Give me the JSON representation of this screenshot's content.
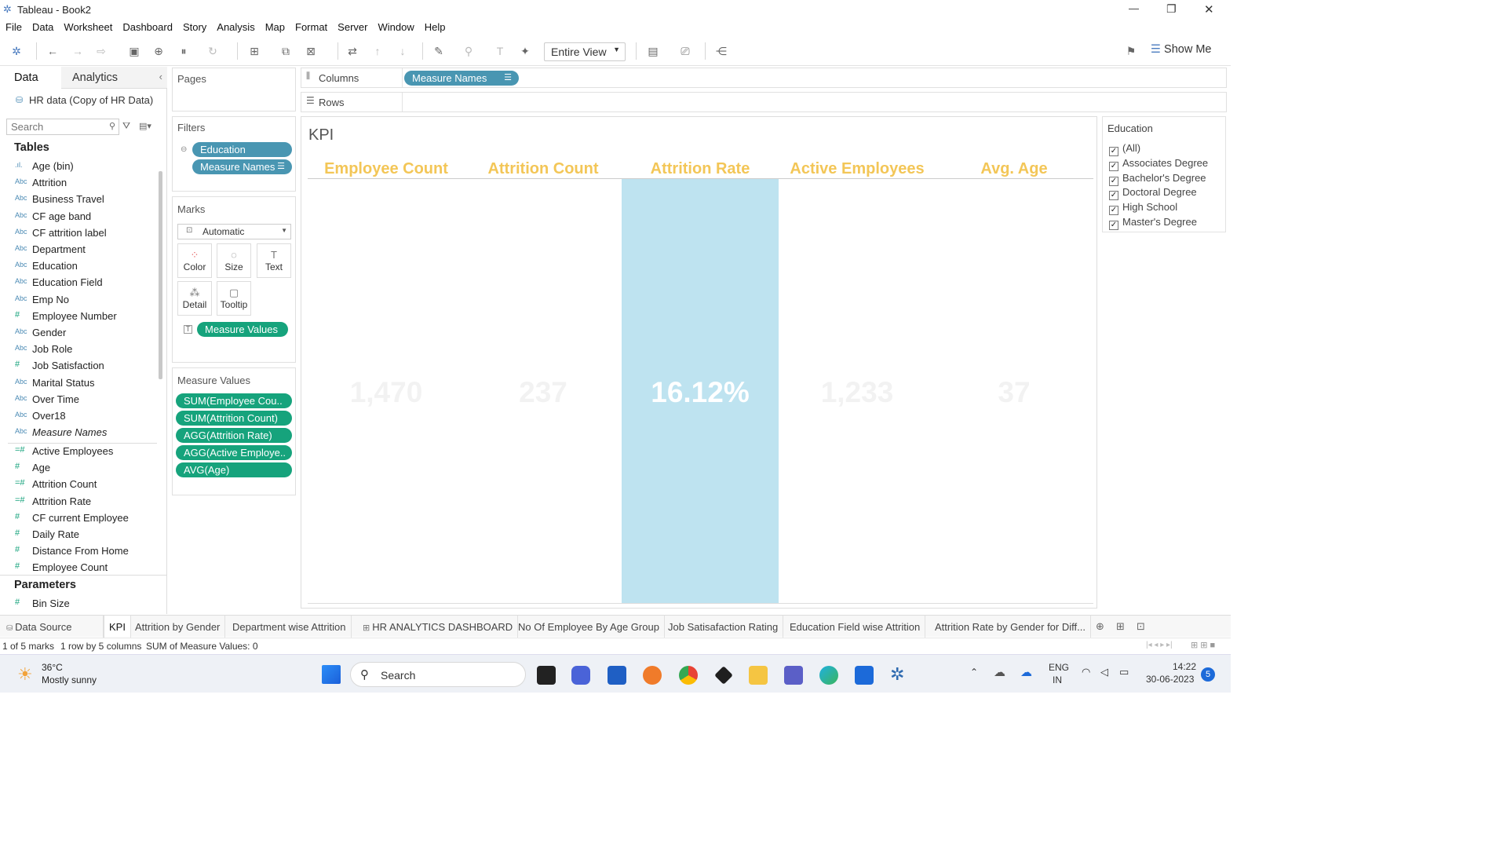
{
  "window": {
    "title": "Tableau - Book2",
    "minimize": "—",
    "restore": "❐",
    "close": "✕"
  },
  "menu": [
    "File",
    "Data",
    "Worksheet",
    "Dashboard",
    "Story",
    "Analysis",
    "Map",
    "Format",
    "Server",
    "Window",
    "Help"
  ],
  "toolbar": {
    "fit": "Entire View",
    "show_me": "Show Me"
  },
  "left": {
    "tab_data": "Data",
    "tab_analytics": "Analytics",
    "source": "HR data (Copy of HR Data)",
    "search_placeholder": "Search",
    "tables_header": "Tables",
    "parameters_header": "Parameters",
    "dims": [
      {
        "t": "Abc",
        "n": "Age (bin)",
        "type": "bin"
      },
      {
        "t": "Abc",
        "n": "Attrition"
      },
      {
        "t": "Abc",
        "n": "Business Travel"
      },
      {
        "t": "Abc",
        "n": "CF age band"
      },
      {
        "t": "Abc",
        "n": "CF attrition label"
      },
      {
        "t": "Abc",
        "n": "Department"
      },
      {
        "t": "Abc",
        "n": "Education"
      },
      {
        "t": "Abc",
        "n": "Education Field"
      },
      {
        "t": "Abc",
        "n": "Emp No"
      },
      {
        "t": "#",
        "n": "Employee Number"
      },
      {
        "t": "Abc",
        "n": "Gender"
      },
      {
        "t": "Abc",
        "n": "Job Role"
      },
      {
        "t": "#",
        "n": "Job Satisfaction"
      },
      {
        "t": "Abc",
        "n": "Marital Status"
      },
      {
        "t": "Abc",
        "n": "Over Time"
      },
      {
        "t": "Abc",
        "n": "Over18"
      },
      {
        "t": "Abc",
        "n": "Measure Names"
      }
    ],
    "measures": [
      {
        "t": "=#",
        "n": "Active Employees"
      },
      {
        "t": "#",
        "n": "Age"
      },
      {
        "t": "=#",
        "n": "Attrition Count"
      },
      {
        "t": "=#",
        "n": "Attrition Rate"
      },
      {
        "t": "#",
        "n": "CF current Employee"
      },
      {
        "t": "#",
        "n": "Daily Rate"
      },
      {
        "t": "#",
        "n": "Distance From Home"
      },
      {
        "t": "#",
        "n": "Employee Count"
      }
    ],
    "params": [
      {
        "t": "#",
        "n": "Bin Size"
      }
    ]
  },
  "shelves": {
    "pages": "Pages",
    "columns": "Columns",
    "rows": "Rows",
    "columns_pill": "Measure Names",
    "filters": "Filters",
    "filter1": "Education",
    "filter2": "Measure Names",
    "marks": "Marks",
    "mark_type": "Automatic",
    "color": "Color",
    "size": "Size",
    "text": "Text",
    "detail": "Detail",
    "tooltip": "Tooltip",
    "marks_pill": "Measure Values",
    "mv_title": "Measure Values",
    "mv": [
      "SUM(Employee Cou..",
      "SUM(Attrition Count)",
      "AGG(Attrition Rate)",
      "AGG(Active Employe..",
      "AVG(Age)"
    ]
  },
  "view": {
    "title": "KPI",
    "highlight_color": "#bee3f0",
    "header_color": "#f3c657",
    "kpis": [
      {
        "label": "Employee Count",
        "value": "1,470"
      },
      {
        "label": "Attrition Count",
        "value": "237"
      },
      {
        "label": "Attrition Rate",
        "value": "16.12%"
      },
      {
        "label": "Active Employees",
        "value": "1,233"
      },
      {
        "label": "Avg. Age",
        "value": "37"
      }
    ]
  },
  "legend": {
    "title": "Education",
    "items": [
      "(All)",
      "Associates Degree",
      "Bachelor's Degree",
      "Doctoral Degree",
      "High School",
      "Master's Degree"
    ]
  },
  "tabs": [
    "Data Source",
    "KPI",
    "Attrition by Gender",
    "Department wise Attrition",
    "HR ANALYTICS DASHBOARD",
    "No Of Employee By Age Group",
    "Job Satisafaction Rating",
    "Education Field wise Attrition",
    "Attrition Rate by Gender for Diff..."
  ],
  "status": {
    "marks": "1 of 5 marks",
    "dims": "1 row by 5 columns",
    "sum": "SUM of Measure Values: 0"
  },
  "taskbar": {
    "temp": "36°C",
    "weather": "Mostly sunny",
    "search": "Search",
    "lang1": "ENG",
    "lang2": "IN",
    "time": "14:22",
    "date": "30-06-2023",
    "badge": "5"
  }
}
